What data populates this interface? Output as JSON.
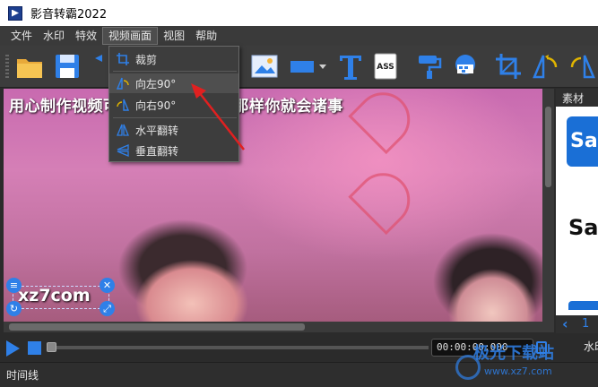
{
  "window": {
    "title": "影音转霸2022"
  },
  "menubar": {
    "items": [
      "文件",
      "水印",
      "特效",
      "视频画面",
      "视图",
      "帮助"
    ],
    "active_index": 3
  },
  "dropdown": {
    "items": [
      {
        "label": "裁剪",
        "icon": "crop-icon"
      },
      {
        "label": "向左90°",
        "icon": "rotate-left-icon"
      },
      {
        "label": "向右90°",
        "icon": "rotate-right-icon"
      },
      {
        "label": "水平翻转",
        "icon": "flip-horizontal-icon"
      },
      {
        "label": "垂直翻转",
        "icon": "flip-vertical-icon"
      }
    ]
  },
  "video": {
    "caption": "用心制作视频可以投一个币啦!! 那样你就会诸事",
    "watermark_text": "xz7com"
  },
  "right_panel": {
    "title": "素材",
    "item_1": "Sa",
    "item_2": "Sa",
    "page": "1"
  },
  "playback": {
    "time": "00:00:00:000",
    "side_label": "水印"
  },
  "timeline": {
    "label": "时间线"
  },
  "site_watermark": {
    "name": "极光下载站",
    "url": "www.xz7.com"
  },
  "colors": {
    "accent": "#2f80e8",
    "annotation_arrow": "#e02020"
  }
}
